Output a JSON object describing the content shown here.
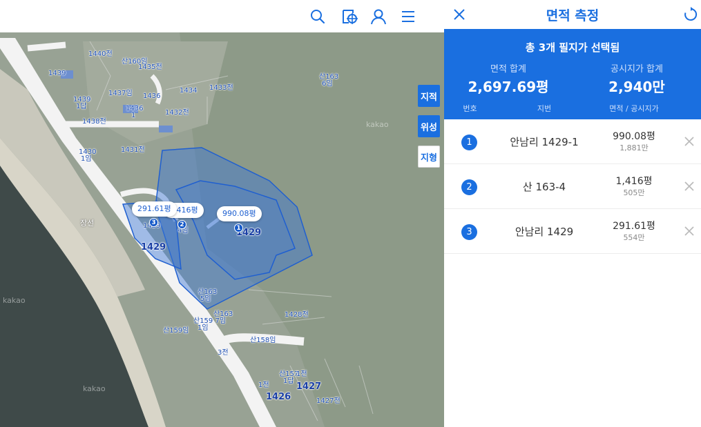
{
  "map": {
    "layers": [
      {
        "label": "지적",
        "active": true
      },
      {
        "label": "위성",
        "active": true
      },
      {
        "label": "지형",
        "active": false
      }
    ],
    "bubbles": [
      "291.61평",
      "1,416평",
      "990.08평"
    ],
    "markers": [
      "1",
      "2",
      "3"
    ],
    "labels": {
      "l1440": "1440전",
      "l160": "산160임",
      "l1435": "1435전",
      "l1439a": "1439",
      "l1437": "1437임",
      "l1436a": "1436",
      "l1434": "1434",
      "l1433": "1433전",
      "l163_6a": "산163",
      "l163_6b": "6임",
      "l1439b": "1439",
      "l1439c": "1답",
      "l1436b": "1436",
      "l1436c": "1",
      "l1432": "1432전",
      "l1438": "1438전",
      "l1431": "1431전",
      "l1430a": "1430",
      "l1430b": "1임",
      "l1429small": "1429",
      "l2sub": "4임",
      "l1429mid": "1429",
      "l1429left": "1429",
      "l163_5a": "산163",
      "l163_5b": "5임",
      "l163_7": "산163",
      "l159_7": "산159 7임",
      "l1임": "1임",
      "l1428": "1428전",
      "l159": "산159임",
      "l158": "산158임",
      "l3": "3전",
      "l157": "산157",
      "l1전b": "1전",
      "l1답b": "1답",
      "l1전c": "1전",
      "l1427": "1427",
      "l1426": "1426",
      "l1427전": "1427전",
      "place": "장선",
      "wm1": "kakao",
      "wm2": "kakao",
      "wm3": "kakao"
    },
    "icons": [
      "search-icon",
      "location-target-icon",
      "user-icon",
      "menu-icon"
    ]
  },
  "panel": {
    "title": "면적 측정",
    "summary_title": "총 3개 필지가 선택됨",
    "area_total_label": "면적 합계",
    "area_total_value": "2,697.69평",
    "price_total_label": "공시지가 합계",
    "price_total_value": "2,940만",
    "columns": [
      "번호",
      "지번",
      "면적 / 공시지가"
    ],
    "rows": [
      {
        "num": "1",
        "address": "안남리 1429-1",
        "area": "990.08평",
        "price": "1,881만"
      },
      {
        "num": "2",
        "address": "산 163-4",
        "area": "1,416평",
        "price": "505만"
      },
      {
        "num": "3",
        "address": "안남리 1429",
        "area": "291.61평",
        "price": "554만"
      }
    ]
  },
  "colors": {
    "accent": "#1a6fe0",
    "parcel_fill": "#3b78d8",
    "parcel_stroke": "#1f5fd0"
  }
}
